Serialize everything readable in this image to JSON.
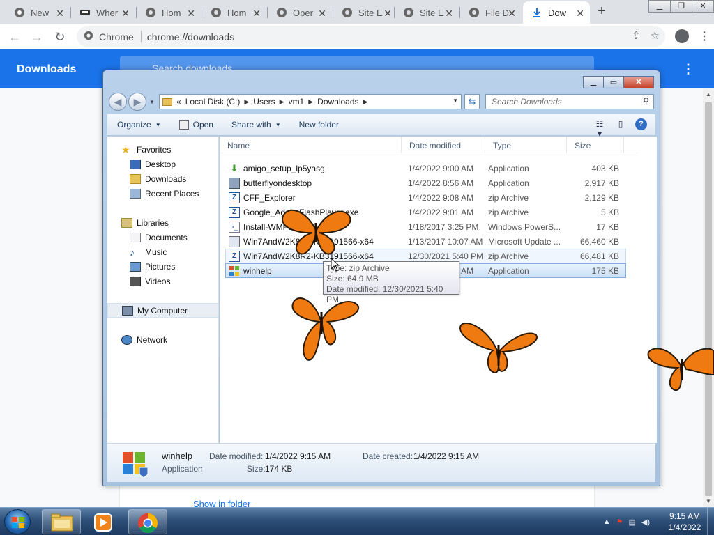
{
  "browser": {
    "tabs": [
      {
        "label": "New",
        "icon": "chrome-icon"
      },
      {
        "label": "Wher",
        "icon": "car-icon"
      },
      {
        "label": "Hom",
        "icon": "globe-icon"
      },
      {
        "label": "Hom",
        "icon": "globe-icon"
      },
      {
        "label": "Oper",
        "icon": "globe-icon"
      },
      {
        "label": "Site E",
        "icon": "globe-icon"
      },
      {
        "label": "Site E",
        "icon": "globe-icon"
      },
      {
        "label": "File D",
        "icon": "globe-icon"
      },
      {
        "label": "Dow",
        "icon": "download-icon",
        "active": true
      }
    ],
    "omnibox": {
      "chip": "Chrome",
      "url": "chrome://downloads"
    },
    "downloads_page": {
      "title": "Downloads",
      "search_placeholder": "Search downloads",
      "show_in_folder": "Show in folder"
    }
  },
  "explorer": {
    "breadcrumb": [
      "Local Disk (C:)",
      "Users",
      "vm1",
      "Downloads"
    ],
    "breadcrumb_prefix": "«",
    "search_placeholder": "Search Downloads",
    "commands": {
      "organize": "Organize",
      "open": "Open",
      "share_with": "Share with",
      "new_folder": "New folder"
    },
    "nav": {
      "favorites": {
        "label": "Favorites",
        "items": [
          "Desktop",
          "Downloads",
          "Recent Places"
        ]
      },
      "libraries": {
        "label": "Libraries",
        "items": [
          "Documents",
          "Music",
          "Pictures",
          "Videos"
        ]
      },
      "computer": "My Computer",
      "network": "Network"
    },
    "columns": {
      "name": "Name",
      "date": "Date modified",
      "type": "Type",
      "size": "Size"
    },
    "files": [
      {
        "name": "amigo_setup_lp5yasg",
        "date": "1/4/2022 9:00 AM",
        "type": "Application",
        "size": "403 KB",
        "icon": "setup-arrow-icon"
      },
      {
        "name": "butterflyondesktop",
        "date": "1/4/2022 8:56 AM",
        "type": "Application",
        "size": "2,917 KB",
        "icon": "installer-icon"
      },
      {
        "name": "CFF_Explorer",
        "date": "1/4/2022 9:08 AM",
        "type": "zip Archive",
        "size": "2,129 KB",
        "icon": "zip-icon"
      },
      {
        "name": "Google_AdobeFlashPlayer.exe",
        "date": "1/4/2022 9:01 AM",
        "type": "zip Archive",
        "size": "5 KB",
        "icon": "zip-icon"
      },
      {
        "name": "Install-WMF5.1",
        "date": "1/18/2017 3:25 PM",
        "type": "Windows PowerS...",
        "size": "17 KB",
        "icon": "powershell-icon"
      },
      {
        "name": "Win7AndW2K8R2-KB3191566-x64",
        "date": "1/13/2017 10:07 AM",
        "type": "Microsoft Update ...",
        "size": "66,460 KB",
        "icon": "update-package-icon"
      },
      {
        "name": "Win7AndW2K8R2-KB3191566-x64",
        "date": "12/30/2021 5:40 PM",
        "type": "zip Archive",
        "size": "66,481 KB",
        "icon": "zip-icon",
        "state": "hovered"
      },
      {
        "name": "winhelp",
        "date": "1/4/2022 9:15 AM",
        "type": "Application",
        "size": "175 KB",
        "icon": "windows-app-icon",
        "state": "selected"
      }
    ],
    "tooltip": {
      "type": "Type: zip Archive",
      "size": "Size: 64.9 MB",
      "modified": "Date modified: 12/30/2021 5:40 PM"
    },
    "details": {
      "name": "winhelp",
      "type": "Application",
      "modified_label": "Date modified:",
      "modified_value": "1/4/2022 9:15 AM",
      "size_label": "Size:",
      "size_value": "174 KB",
      "created_label": "Date created:",
      "created_value": "1/4/2022 9:15 AM"
    }
  },
  "taskbar": {
    "pinned": [
      "explorer-icon",
      "media-player-icon",
      "chrome-icon"
    ],
    "time": "9:15 AM",
    "date": "1/4/2022"
  }
}
